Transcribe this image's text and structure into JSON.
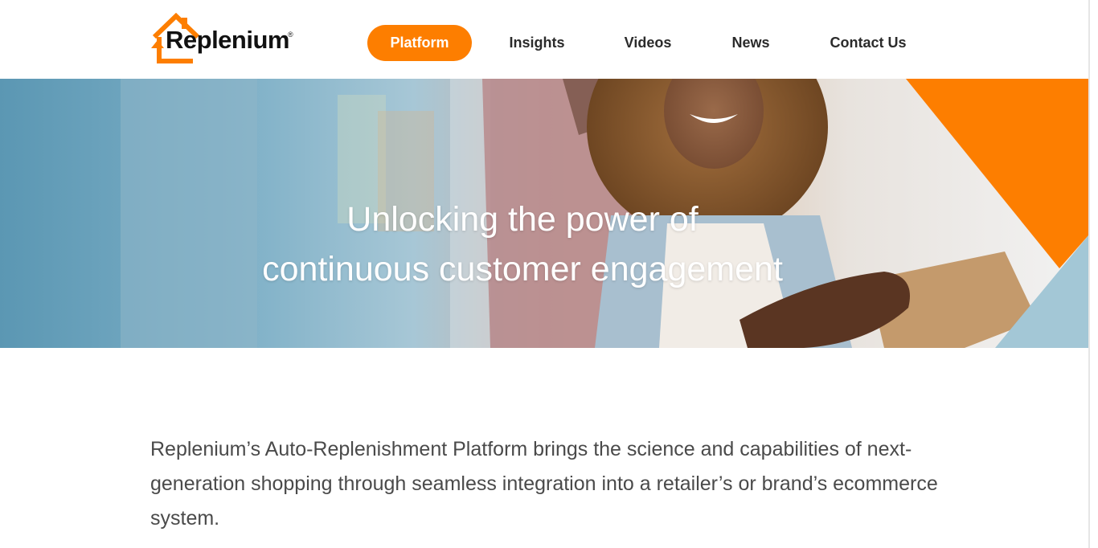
{
  "brand": {
    "name": "Replenium",
    "trademark": "®",
    "accent_color": "#fd7e00",
    "secondary_color": "#a3c7d6"
  },
  "nav": {
    "items": [
      {
        "label": "Platform",
        "active": true
      },
      {
        "label": "Insights",
        "active": false
      },
      {
        "label": "Videos",
        "active": false
      },
      {
        "label": "News",
        "active": false
      },
      {
        "label": "Contact Us",
        "active": false
      }
    ]
  },
  "hero": {
    "title_line1": "Unlocking the power of",
    "title_line2": "continuous customer engagement",
    "image": "woman-receiving-grocery-bag-photo"
  },
  "intro": {
    "text": "Replenium’s Auto-Replenishment Platform brings the science and capabilities of next-generation shopping through seamless integration into a retailer’s or brand’s ecommerce system."
  }
}
